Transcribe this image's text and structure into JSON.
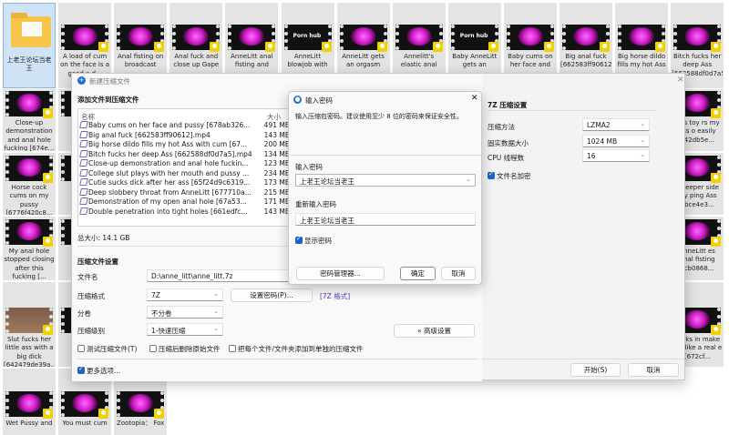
{
  "desktop": {
    "tiles": [
      {
        "col": 0,
        "row": 0,
        "kind": "folder",
        "label": "上老王论坛当老王",
        "selected": true
      },
      {
        "col": 1,
        "row": 0,
        "kind": "video",
        "label": "A load of cum on the face is a good a d..."
      },
      {
        "col": 2,
        "row": 0,
        "kind": "video",
        "label": "Anal fisting on broadcast"
      },
      {
        "col": 3,
        "row": 0,
        "kind": "video",
        "label": "Anal fuck and close up Gape"
      },
      {
        "col": 4,
        "row": 0,
        "kind": "video",
        "label": "AnneLitt anal fisting and"
      },
      {
        "col": 5,
        "row": 0,
        "kind": "ph",
        "label": "AnneLitt blowjob with"
      },
      {
        "col": 6,
        "row": 0,
        "kind": "video",
        "label": "AnneLitt gets an orgasm"
      },
      {
        "col": 7,
        "row": 0,
        "kind": "video",
        "label": "Annelitt's elastic anal"
      },
      {
        "col": 8,
        "row": 0,
        "kind": "ph",
        "label": "Baby AnneLitt gets an"
      },
      {
        "col": 9,
        "row": 0,
        "kind": "video",
        "label": "Baby cums on her face and"
      },
      {
        "col": 10,
        "row": 0,
        "kind": "video",
        "label": "Big anal fuck [662583ff90612"
      },
      {
        "col": 11,
        "row": 0,
        "kind": "video",
        "label": "Big horse dildo fills my hot Ass"
      },
      {
        "col": 12,
        "row": 0,
        "kind": "video",
        "label": "Bitch fucks her deep Ass [662588df0d7a5].mp4"
      },
      {
        "col": 0,
        "row": 1,
        "kind": "video",
        "label": "Close-up demonstration and anal hole fucking [674e..."
      },
      {
        "col": 0,
        "row": 2,
        "kind": "video",
        "label": "Horse cock cums on my pussy [6776f420c8..."
      },
      {
        "col": 0,
        "row": 3,
        "kind": "video",
        "label": "My anal hole stopped closing after this fucking [..."
      },
      {
        "col": 0,
        "row": 4,
        "kind": "room",
        "label": "Slut fucks her little ass with a big dick [642479de39a..."
      },
      {
        "col": 0,
        "row": 5,
        "kind": "video",
        "label": "Wet Pussy and"
      },
      {
        "col": 1,
        "row": 1,
        "kind": "video",
        "label": ""
      },
      {
        "col": 1,
        "row": 2,
        "kind": "video",
        "label": ""
      },
      {
        "col": 1,
        "row": 3,
        "kind": "video",
        "label": ""
      },
      {
        "col": 1,
        "row": 4,
        "kind": "video",
        "label": ""
      },
      {
        "col": 1,
        "row": 5,
        "kind": "video",
        "label": "You must cum"
      },
      {
        "col": 2,
        "row": 5,
        "kind": "video",
        "label": "Zootopia： Fox"
      },
      {
        "col": 12,
        "row": 1,
        "kind": "video",
        "label": "lass toy rs my ass o easily 742db5e..."
      },
      {
        "col": 12,
        "row": 2,
        "kind": "video",
        "label": "k deeper side my ping Ass abce4e3..."
      },
      {
        "col": 12,
        "row": 3,
        "kind": "video",
        "label": "AnneLitt es anal fisting ccb0868..."
      },
      {
        "col": 12,
        "row": 4,
        "kind": "video",
        "label": "cocks in make me like a real e [672cf..."
      }
    ]
  },
  "main": {
    "title": "新建压缩文件",
    "add_heading": "添加文件到压缩文件",
    "col_name": "名称",
    "col_size": "大小",
    "files": [
      {
        "name": "Baby cums on her face and pussy [678ab326...",
        "size": "491 MB"
      },
      {
        "name": "Big anal fuck [662583ff90612].mp4",
        "size": "143 MB"
      },
      {
        "name": "Big horse dildo fills my hot Ass with cum [67...",
        "size": "200 MB"
      },
      {
        "name": "Bitch fucks her deep Ass [662588df0d7a5].mp4",
        "size": "134 MB"
      },
      {
        "name": "Close-up demonstration and anal hole fuckin...",
        "size": "123 MB"
      },
      {
        "name": "College slut plays with her mouth and pussy ...",
        "size": "234 MB"
      },
      {
        "name": "Cutie sucks dick after her ass [65f24d9c6319...",
        "size": "173 MB"
      },
      {
        "name": "Deep slobbery throat from AnneLitt [677710a...",
        "size": "215 MB"
      },
      {
        "name": "Demonstration of my open anal hole [67a53...",
        "size": "171 MB"
      },
      {
        "name": "Double penetration into tight holes [661edfc...",
        "size": "143 MB"
      }
    ],
    "total": "总大小: 14.1 GB",
    "settings_heading": "压缩文件设置",
    "filename_label": "文件名",
    "filename_value": "D:\\anne_litt\\anne_litt.7z",
    "format_label": "压缩格式",
    "format_value": "7Z",
    "set_password": "设置密码(P)...",
    "format_link": "[7Z 格式]",
    "split_label": "分卷",
    "split_value": "不分卷",
    "level_label": "压缩级别",
    "level_value": "1-快速压缩",
    "advanced": "« 高级设置",
    "cb_test": "测试压缩文件(T)",
    "cb_delete": "压缩后删除原始文件",
    "cb_each": "把每个文件/文件夹添加到单独的压缩文件",
    "more_options": "更多选项...",
    "right_heading": "7Z 压缩设置",
    "method_label": "压缩方法",
    "method_value": "LZMA2",
    "solid_label": "固实数据大小",
    "solid_value": "1024 MB",
    "cpu_label": "CPU 线程数",
    "cpu_value": "16",
    "encrypt_names": "文件名加密",
    "start": "开始(S)",
    "cancel": "取消"
  },
  "pwd": {
    "title": "输入密码",
    "hint": "输入压缩包密码。建议使用至少 8 位的密码来保证安全性。",
    "enter_label": "输入密码",
    "enter_value": "上老王论坛当老王",
    "reenter_label": "重新输入密码",
    "reenter_value": "上老王论坛当老王",
    "show": "显示密码",
    "manager": "密码管理器...",
    "ok": "确定",
    "cancel": "取消"
  }
}
